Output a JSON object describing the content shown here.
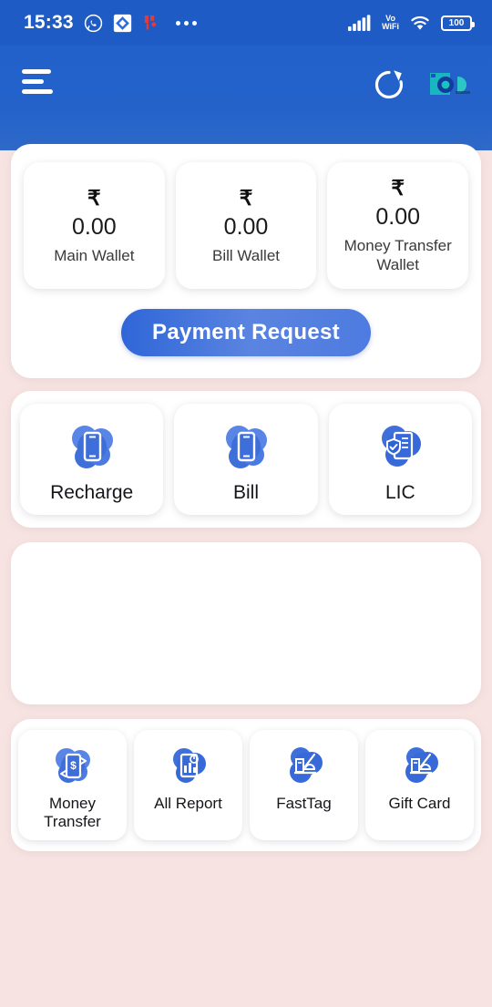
{
  "status_bar": {
    "time": "15:33",
    "left_icons": [
      "whatsapp-icon",
      "maps-icon",
      "notification-icon",
      "more-dots-icon"
    ],
    "network_label_top": "Vo",
    "network_label_bottom": "WiFi",
    "battery_level": "100",
    "right_icons": [
      "signal-bars-icon",
      "vowifi-icon",
      "wifi-icon",
      "battery-icon"
    ]
  },
  "app_bar": {
    "menu_icon": "hamburger-menu-icon",
    "refresh_icon": "refresh-icon",
    "logo": "brand-logo"
  },
  "wallets": [
    {
      "currency": "₹",
      "amount": "0.00",
      "label": "Main Wallet"
    },
    {
      "currency": "₹",
      "amount": "0.00",
      "label": "Bill Wallet"
    },
    {
      "currency": "₹",
      "amount": "0.00",
      "label": "Money Transfer Wallet"
    }
  ],
  "payment_request": {
    "label": "Payment Request"
  },
  "services": [
    {
      "label": "Recharge",
      "icon": "mobile-recharge-icon"
    },
    {
      "label": "Bill",
      "icon": "mobile-bill-icon"
    },
    {
      "label": "LIC",
      "icon": "insurance-document-icon"
    }
  ],
  "banner": {
    "content": ""
  },
  "bottom_services": [
    {
      "label": "Money Transfer",
      "icon": "money-transfer-icon"
    },
    {
      "label": "All Report",
      "icon": "report-chart-icon"
    },
    {
      "label": "FastTag",
      "icon": "toll-booth-icon"
    },
    {
      "label": "Gift Card",
      "icon": "gift-card-icon"
    }
  ],
  "colors": {
    "header_blue": "#2161C9",
    "background_pink": "#F7E4E2",
    "accent_blue": "#2F66D8",
    "icon_blue": "#2A63D4",
    "card_white": "#FFFFFF"
  }
}
